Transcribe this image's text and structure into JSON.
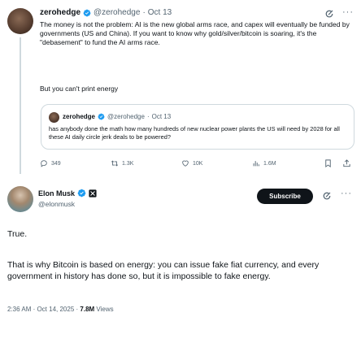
{
  "parent_post": {
    "author_name": "zerohedge",
    "author_handle": "@zerohedge",
    "separator": "·",
    "date": "Oct 13",
    "text": "The money is not the problem: AI is the new global arms race, and capex will eventually be funded by governments (US and China). If you want to know why gold/silver/bitcoin is soaring, it's the \"debasement\" to fund the AI arms race.",
    "text_2": "But you can't print energy",
    "quoted": {
      "author_name": "zerohedge",
      "author_handle": "@zerohedge",
      "separator": "·",
      "date": "Oct 13",
      "text": "has anybody done the math how many hundreds of new nuclear power plants the US will need by 2028 for all these AI daily circle jerk deals to be powered?"
    },
    "actions": {
      "replies": "349",
      "reposts": "1.3K",
      "likes": "10K",
      "views": "1.6M"
    }
  },
  "main_post": {
    "author_name": "Elon Musk",
    "author_handle": "@elonmusk",
    "subscribe_label": "Subscribe",
    "text_1": "True.",
    "text_2": "That is why Bitcoin is based on energy: you can issue fake fiat currency, and every government in history has done so, but it is impossible to fake energy.",
    "timestamp": "2:36 AM · Oct 14, 2025 · ",
    "views_count": "7.8M",
    "views_label": " Views"
  },
  "colors": {
    "text": "#0f1419",
    "muted": "#536471",
    "verified": "#1d9bf0",
    "border": "#cfd9de"
  }
}
